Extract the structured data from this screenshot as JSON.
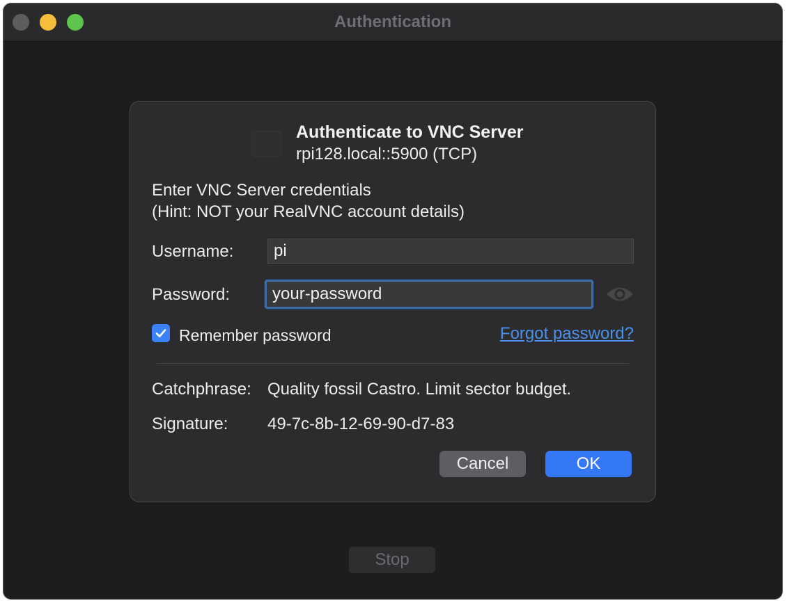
{
  "window": {
    "title": "Authentication",
    "stop_label": "Stop"
  },
  "dialog": {
    "title": "Authenticate to VNC Server",
    "subtitle": "rpi128.local::5900 (TCP)",
    "instruction_line1": "Enter VNC Server credentials",
    "instruction_line2": "(Hint: NOT your RealVNC account details)",
    "username_label": "Username:",
    "username_value": "pi",
    "password_label": "Password:",
    "password_value": "your-password",
    "show_password_icon": "eye-icon",
    "remember_label": "Remember password",
    "remember_checked": true,
    "forgot_link": "Forgot password?",
    "catchphrase_label": "Catchphrase:",
    "catchphrase_value": "Quality fossil Castro. Limit sector budget.",
    "signature_label": "Signature:",
    "signature_value": "49-7c-8b-12-69-90-d7-83",
    "cancel_label": "Cancel",
    "ok_label": "OK"
  },
  "colors": {
    "accent": "#3478f6",
    "link": "#4a90e8",
    "window_bg": "#1d1d1f",
    "dialog_bg": "#2c2c2e"
  }
}
